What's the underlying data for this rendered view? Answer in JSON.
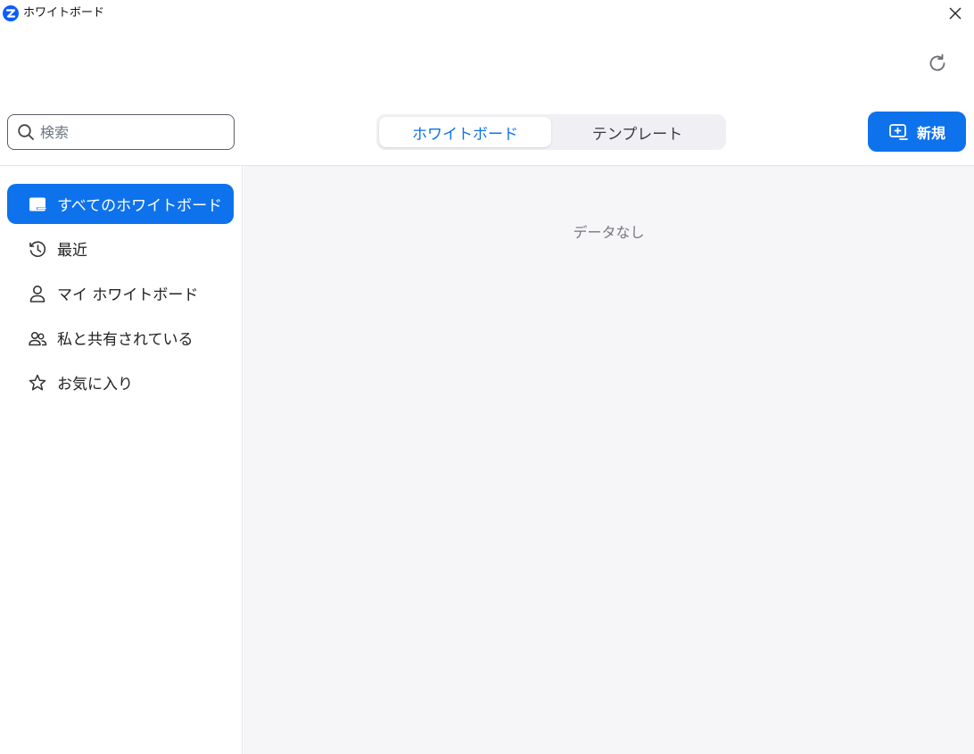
{
  "window": {
    "title": "ホワイトボード"
  },
  "toolbar": {
    "search_placeholder": "検索",
    "tabs": [
      {
        "label": "ホワイトボード",
        "active": true
      },
      {
        "label": "テンプレート",
        "active": false
      }
    ],
    "new_label": "新規"
  },
  "sidebar": {
    "items": [
      {
        "label": "すべてのホワイトボード",
        "icon": "whiteboard-icon",
        "active": true
      },
      {
        "label": "最近",
        "icon": "clock-icon",
        "active": false
      },
      {
        "label": "マイ ホワイトボード",
        "icon": "user-icon",
        "active": false
      },
      {
        "label": "私と共有されている",
        "icon": "people-icon",
        "active": false
      },
      {
        "label": "お気に入り",
        "icon": "star-icon",
        "active": false
      }
    ]
  },
  "main": {
    "empty_text": "データなし"
  },
  "colors": {
    "accent": "#0e72ed",
    "logo": "#0b5cff",
    "main_bg": "#f6f6f8"
  }
}
